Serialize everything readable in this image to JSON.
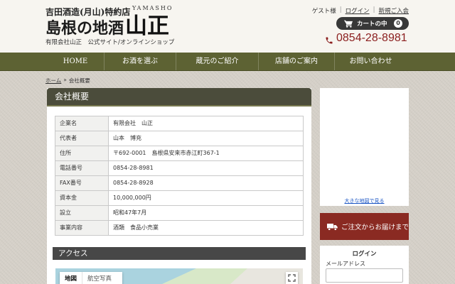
{
  "header": {
    "tagline": "吉田酒造(月山)特約店",
    "title": "島根の地酒",
    "logo_kanji": "山正",
    "logo_roman": "YAMASHO",
    "subtitle": "有限会社山正　公式サイト/オンラインショップ",
    "user_links": {
      "guest": "ゲスト様",
      "separator": "|",
      "login": "ログイン",
      "register": "新規ご入会"
    },
    "cart": {
      "label": "カートの中",
      "count": "0",
      "icon": "cart-icon"
    },
    "phone": {
      "number": "0854-28-8981",
      "icon": "phone-icon"
    }
  },
  "nav": [
    {
      "label": "HOME"
    },
    {
      "label": "お酒を選ぶ"
    },
    {
      "label": "蔵元のご紹介"
    },
    {
      "label": "店舗のご案内"
    },
    {
      "label": "お問い合わせ"
    }
  ],
  "breadcrumb": {
    "home": "ホーム",
    "separator": "»",
    "current": "会社概要"
  },
  "main": {
    "heading": "会社概要",
    "company_table": [
      {
        "label": "企業名",
        "value": "有限会社　山正"
      },
      {
        "label": "代表者",
        "value": "山本　博充"
      },
      {
        "label": "住所",
        "value": "〒692-0001　島根県安来市赤江町367-1"
      },
      {
        "label": "電話番号",
        "value": "0854-28-8981"
      },
      {
        "label": "FAX番号",
        "value": "0854-28-8928"
      },
      {
        "label": "資本金",
        "value": "10,000,000円"
      },
      {
        "label": "設立",
        "value": "昭和47年7月"
      },
      {
        "label": "事業内容",
        "value": "酒類　食品小売業"
      }
    ],
    "access_heading": "アクセス",
    "map": {
      "tab_map": "地図",
      "tab_satellite": "航空写真",
      "fullscreen_icon": "fullscreen-icon"
    }
  },
  "sidebar": {
    "map_link": "大きな地図で見る",
    "delivery_button": {
      "label": "ご注文からお届けまで",
      "icon": "truck-icon"
    },
    "login": {
      "heading": "ログイン",
      "email_label": "メールアドレス"
    }
  },
  "colors": {
    "nav_bg": "#5d6233",
    "phone_text": "#8b1e1e",
    "delivery_button_bg": "#8a2a22",
    "section_heading_bg": "#4b4c3b",
    "cart_button_bg": "#383838"
  }
}
